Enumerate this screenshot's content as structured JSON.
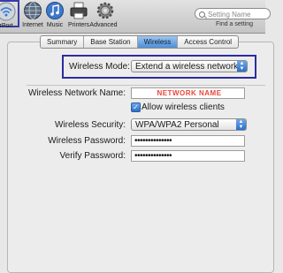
{
  "toolbar": {
    "items": [
      {
        "label": "AirPort",
        "icon": "airport-icon"
      },
      {
        "label": "Internet",
        "icon": "globe-icon"
      },
      {
        "label": "Music",
        "icon": "music-icon"
      },
      {
        "label": "Printers",
        "icon": "printer-icon"
      },
      {
        "label": "Advanced",
        "icon": "gear-icon"
      }
    ],
    "search_placeholder": "Setting Name",
    "find_setting": "Find a setting"
  },
  "tabs": [
    {
      "label": "Summary",
      "active": false
    },
    {
      "label": "Base Station",
      "active": false
    },
    {
      "label": "Wireless",
      "active": true
    },
    {
      "label": "Access Control",
      "active": false
    }
  ],
  "form": {
    "wireless_mode_label": "Wireless Mode:",
    "wireless_mode_value": "Extend a wireless network",
    "network_name_label": "Wireless Network Name:",
    "network_name_value": "NETWORK NAME",
    "allow_clients_label": "Allow wireless clients",
    "allow_clients_checked": true,
    "security_label": "Wireless Security:",
    "security_value": "WPA/WPA2 Personal",
    "password_label": "Wireless Password:",
    "password_value": "••••••••••••••",
    "verify_label": "Verify Password:",
    "verify_value": "••••••••••••••"
  },
  "colors": {
    "highlight_border": "#2c2ca0",
    "network_name_text": "#e8463a",
    "active_tab": "#4d8fd8"
  }
}
